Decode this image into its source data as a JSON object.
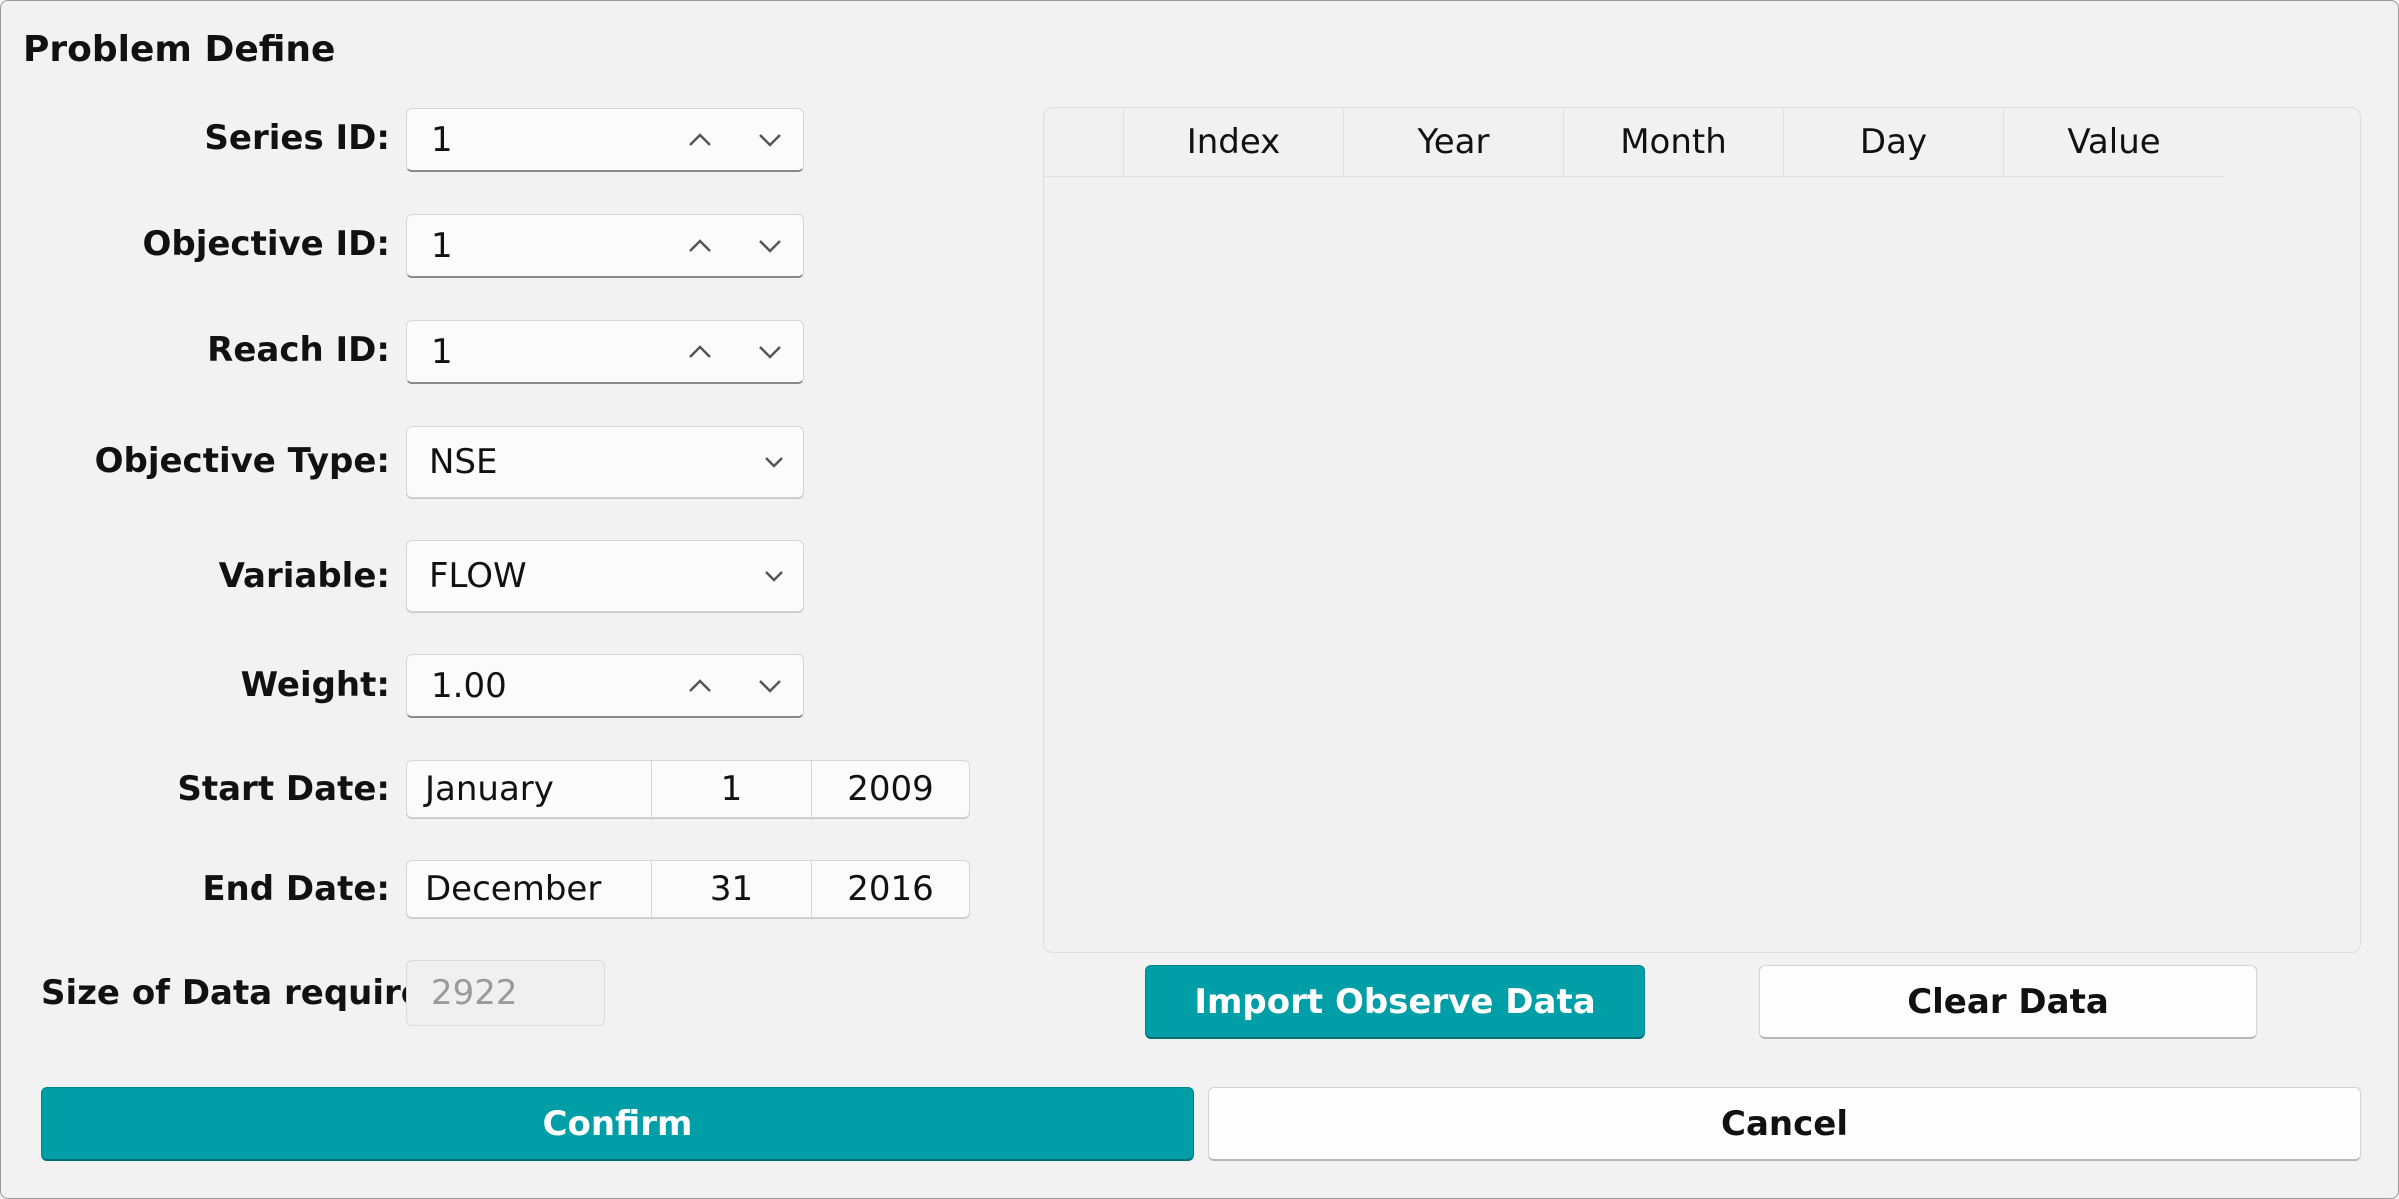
{
  "dialog": {
    "title": "Problem Define"
  },
  "form": {
    "series_id": {
      "label": "Series ID:",
      "value": "1"
    },
    "objective_id": {
      "label": "Objective ID:",
      "value": "1"
    },
    "reach_id": {
      "label": "Reach ID:",
      "value": "1"
    },
    "objective_type": {
      "label": "Objective Type:",
      "value": "NSE"
    },
    "variable": {
      "label": "Variable:",
      "value": "FLOW"
    },
    "weight": {
      "label": "Weight:",
      "value": "1.00"
    },
    "start_date": {
      "label": "Start Date:",
      "month": "January",
      "day": "1",
      "year": "2009"
    },
    "end_date": {
      "label": "End Date:",
      "month": "December",
      "day": "31",
      "year": "2016"
    },
    "size_required": {
      "label": "Size of Data required:",
      "value": "2922"
    }
  },
  "table": {
    "columns": [
      "",
      "Index",
      "Year",
      "Month",
      "Day",
      "Value"
    ],
    "rows": []
  },
  "buttons": {
    "import_label": "Import Observe Data",
    "clear_label": "Clear Data",
    "confirm_label": "Confirm",
    "cancel_label": "Cancel"
  },
  "colors": {
    "accent": "#009ea6"
  },
  "icons": {
    "spin_up": "chevron-up-icon",
    "spin_down": "chevron-down-icon",
    "dropdown": "chevron-down-icon"
  }
}
